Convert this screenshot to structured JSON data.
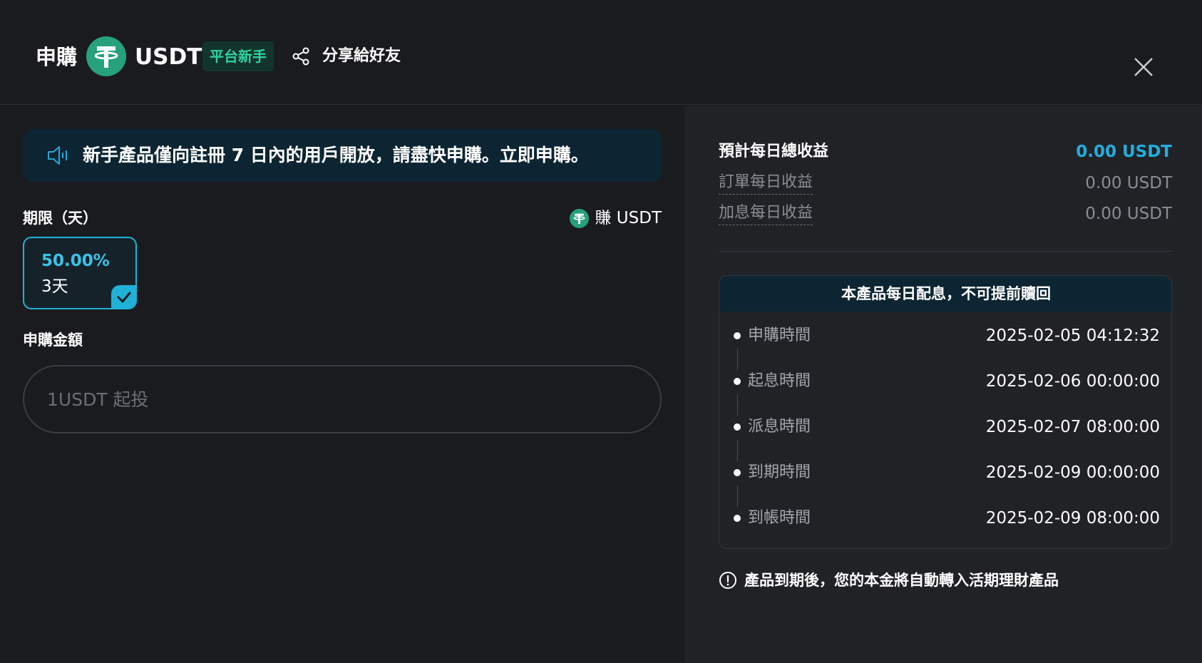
{
  "header": {
    "title": "申購",
    "coin": "USDT",
    "badge": "平台新手",
    "share_label": "分享給好友"
  },
  "notice": {
    "text": "新手產品僅向註冊 7 日內的用戶開放，請盡快申購。立即申購。"
  },
  "term": {
    "label": "期限（天）",
    "earn_label": "賺 USDT",
    "options": [
      {
        "rate": "50.00%",
        "days": "3天",
        "selected": true
      }
    ]
  },
  "amount": {
    "label": "申購金額",
    "placeholder": "1USDT 起投",
    "value": ""
  },
  "summary": {
    "total_label": "預計每日總收益",
    "total_value": "0.00 USDT",
    "order_label": "訂單每日收益",
    "order_value": "0.00 USDT",
    "bonus_label": "加息每日收益",
    "bonus_value": "0.00 USDT"
  },
  "timeline": {
    "title": "本產品每日配息，不可提前贖回",
    "rows": [
      {
        "label": "申購時間",
        "value": "2025-02-05 04:12:32"
      },
      {
        "label": "起息時間",
        "value": "2025-02-06 00:00:00"
      },
      {
        "label": "派息時間",
        "value": "2025-02-07 08:00:00"
      },
      {
        "label": "到期時間",
        "value": "2025-02-09 00:00:00"
      },
      {
        "label": "到帳時間",
        "value": "2025-02-09 08:00:00"
      }
    ]
  },
  "footnote": {
    "text": "產品到期後，您的本金將自動轉入活期理財產品"
  },
  "colors": {
    "accent": "#1fb2d6",
    "tether": "#26a17b",
    "badge_text": "#2fd39b",
    "notice_bg": "#0d2532"
  },
  "icons": {
    "coin": "tether-icon",
    "share": "share-icon",
    "close": "close-icon",
    "notice": "speaker-icon",
    "check": "check-icon",
    "info": "info-icon"
  }
}
